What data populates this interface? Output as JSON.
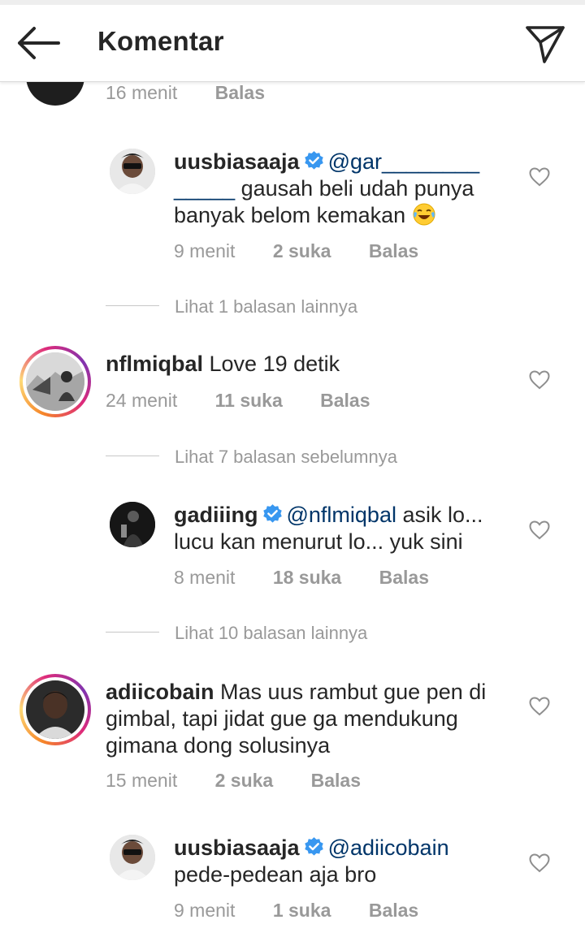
{
  "header": {
    "title": "Komentar",
    "back_icon": "arrow-left-icon",
    "send_icon": "paper-plane-icon"
  },
  "colors": {
    "mention": "#003569",
    "verified": "#3897f0",
    "meta": "#999999",
    "text": "#262626"
  },
  "top_partial": {
    "time": "16 menit",
    "reply": "Balas"
  },
  "comments": [
    {
      "username": "uusbiasaaja",
      "verified": true,
      "mention": "@gar________",
      "mention_cont": "_____",
      "text_line1": "gausah beli udah punya",
      "text_line2": "banyak belom kemakan",
      "emoji": "face-with-tears-of-joy",
      "time": "9 menit",
      "likes": "2 suka",
      "reply": "Balas"
    },
    {
      "more_replies": "Lihat 1 balasan lainnya"
    },
    {
      "username": "nflmiqbal",
      "text": "Love 19 detik",
      "time": "24 menit",
      "likes": "11 suka",
      "reply": "Balas"
    },
    {
      "more_replies": "Lihat 7 balasan sebelumnya"
    },
    {
      "username": "gadiiing",
      "verified": true,
      "mention": "@nflmiqbal",
      "text_line1": "asik lo...",
      "text_line2": "lucu kan menurut lo... yuk sini",
      "time": "8 menit",
      "likes": "18 suka",
      "reply": "Balas"
    },
    {
      "more_replies": "Lihat 10 balasan lainnya"
    },
    {
      "username": "adiicobain",
      "text_line1": "Mas uus rambut gue pen di",
      "text_line2": "gimbal, tapi jidat gue ga mendukung",
      "text_line3": "gimana dong solusinya",
      "time": "15 menit",
      "likes": "2 suka",
      "reply": "Balas"
    },
    {
      "username": "uusbiasaaja",
      "verified": true,
      "mention": "@adiicobain",
      "text_line2": "pede-pedean aja bro",
      "time": "9 menit",
      "likes": "1 suka",
      "reply": "Balas"
    }
  ]
}
